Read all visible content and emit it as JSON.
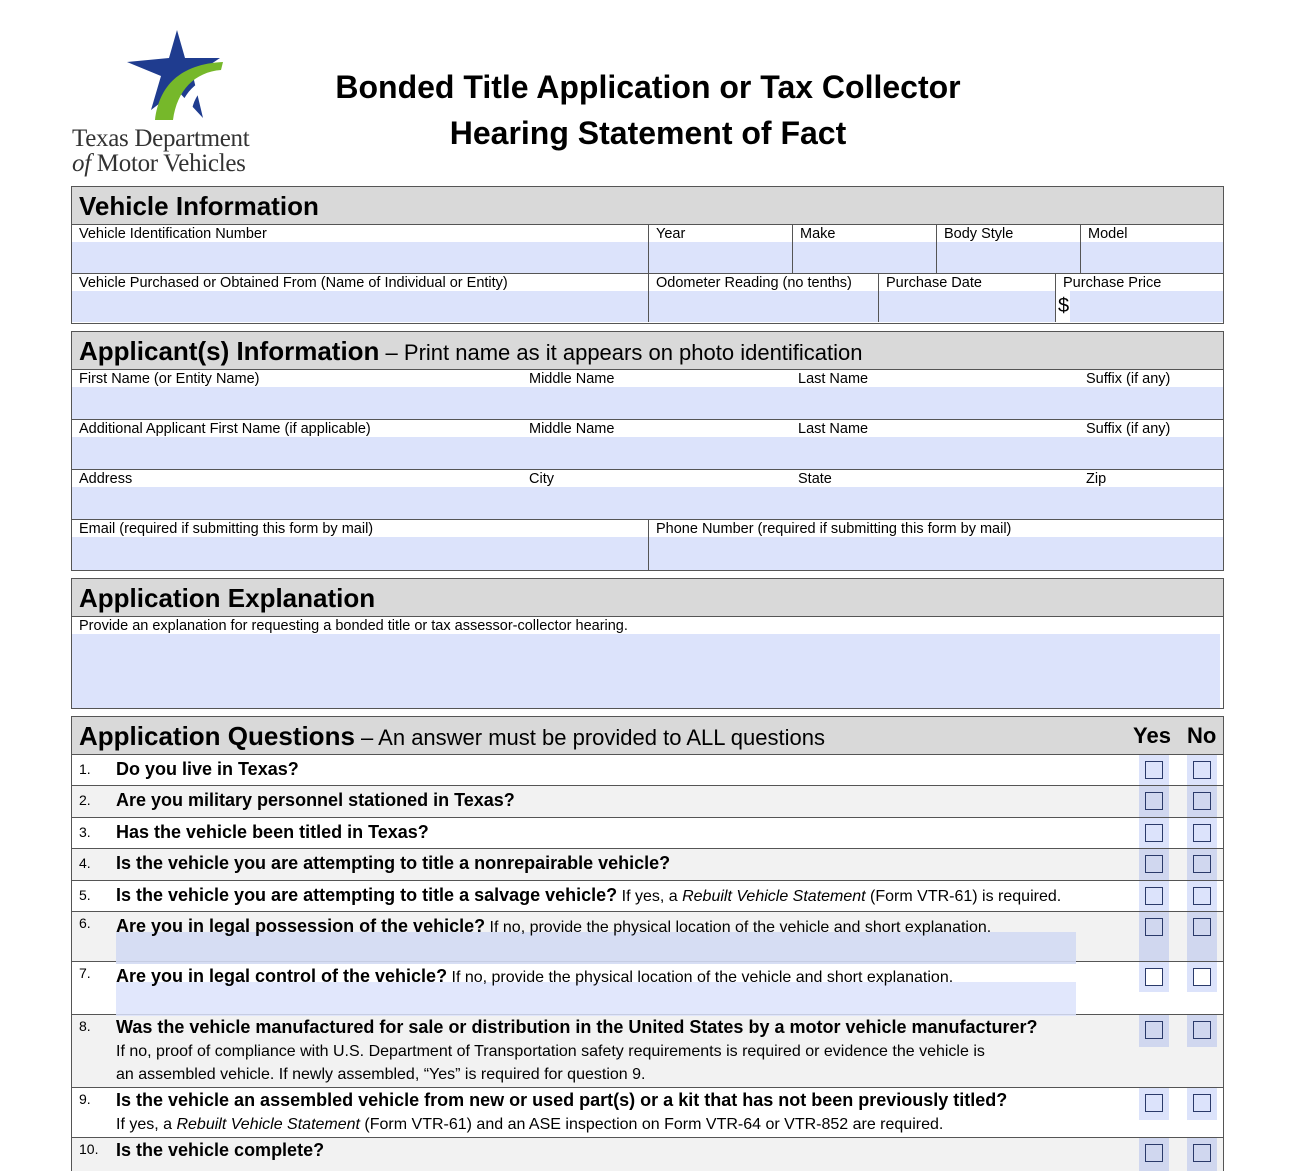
{
  "logo": {
    "line1": "Texas Department",
    "line2_of": "of",
    "line2_rest": " Motor Vehicles",
    "colors": {
      "star_blue": "#1f3c8f",
      "swoosh_green": "#76b82a"
    }
  },
  "title": {
    "line1": "Bonded Title Application or Tax Collector",
    "line2": "Hearing Statement of Fact"
  },
  "vehicle_information": {
    "heading": "Vehicle Information",
    "row1": [
      {
        "label": "Vehicle Identification Number",
        "value": ""
      },
      {
        "label": "Year",
        "value": ""
      },
      {
        "label": "Make",
        "value": ""
      },
      {
        "label": "Body Style",
        "value": ""
      },
      {
        "label": "Model",
        "value": ""
      }
    ],
    "row2": [
      {
        "label": "Vehicle Purchased or Obtained From (Name of Individual or Entity)",
        "value": ""
      },
      {
        "label": "Odometer Reading (no tenths)",
        "value": ""
      },
      {
        "label": "Purchase Date",
        "value": ""
      },
      {
        "label": "Purchase Price",
        "prefix": "$",
        "value": ""
      }
    ]
  },
  "applicant_information": {
    "heading": "Applicant(s) Information",
    "subheading": " – Print name as it appears on photo identification",
    "row1": [
      {
        "label": "First Name (or Entity Name)",
        "value": ""
      },
      {
        "label": "Middle Name",
        "value": ""
      },
      {
        "label": "Last Name",
        "value": ""
      },
      {
        "label": "Suffix (if any)",
        "value": ""
      }
    ],
    "row2": [
      {
        "label": "Additional Applicant First Name (if applicable)",
        "value": ""
      },
      {
        "label": "Middle Name",
        "value": ""
      },
      {
        "label": "Last Name",
        "value": ""
      },
      {
        "label": "Suffix (if any)",
        "value": ""
      }
    ],
    "row3": [
      {
        "label": "Address",
        "value": ""
      },
      {
        "label": "City",
        "value": ""
      },
      {
        "label": "State",
        "value": ""
      },
      {
        "label": "Zip",
        "value": ""
      }
    ],
    "row4": [
      {
        "label": "Email (required if submitting this form by mail)",
        "value": ""
      },
      {
        "label": "Phone Number (required if submitting this form by mail)",
        "value": ""
      }
    ]
  },
  "application_explanation": {
    "heading": "Application Explanation",
    "label": "Provide an explanation for requesting a bonded title or tax assessor-collector hearing.",
    "value": ""
  },
  "application_questions": {
    "heading": "Application Questions",
    "subheading": " – An answer must be provided to ALL questions",
    "yes_label": "Yes",
    "no_label": "No",
    "questions": [
      {
        "num": "1.",
        "bold": "Do you live in Texas?",
        "rest": "",
        "yes": false,
        "no": false
      },
      {
        "num": "2.",
        "bold": "Are you military personnel stationed in Texas?",
        "rest": "",
        "yes": false,
        "no": false
      },
      {
        "num": "3.",
        "bold": "Has the vehicle been titled in Texas?",
        "rest": "",
        "yes": false,
        "no": false
      },
      {
        "num": "4.",
        "bold": "Is the vehicle you are attempting to title a nonrepairable vehicle?",
        "rest": "",
        "yes": false,
        "no": false
      },
      {
        "num": "5.",
        "bold": "Is the vehicle you are attempting to title a salvage vehicle?",
        "rest_a": " If yes, a ",
        "rest_italic": "Rebuilt Vehicle Statement",
        "rest_b": " (Form VTR-61) is required.",
        "yes": false,
        "no": false
      },
      {
        "num": "6.",
        "bold": "Are you in legal possession of the vehicle?",
        "rest": " If no, provide the physical location of the vehicle and short explanation.",
        "explanation": "",
        "yes": false,
        "no": false
      },
      {
        "num": "7.",
        "bold": "Are you in legal control of the vehicle?",
        "rest": " If no, provide the physical location of the vehicle and short explanation.",
        "explanation": "",
        "yes": false,
        "no": false
      },
      {
        "num": "8.",
        "bold": "Was the vehicle manufactured for sale or distribution in the United States by a motor vehicle manufacturer?",
        "sub1": "If no, proof of compliance with U.S. Department of Transportation safety requirements is required or evidence the vehicle is",
        "sub2": "an assembled vehicle. If newly assembled, “Yes” is required for question 9.",
        "yes": false,
        "no": false
      },
      {
        "num": "9.",
        "bold": "Is the vehicle an assembled vehicle from new or used part(s) or a kit that has not been previously titled?",
        "sub_a": "If yes, a ",
        "sub_italic": "Rebuilt Vehicle Statement",
        "sub_b": " (Form VTR-61) and an ASE inspection on Form VTR-64 or VTR-852 are required.",
        "yes": false,
        "no": false
      },
      {
        "num": "10.",
        "bold": "Is the vehicle complete?",
        "rest": "",
        "yes": false,
        "no": false
      }
    ]
  }
}
